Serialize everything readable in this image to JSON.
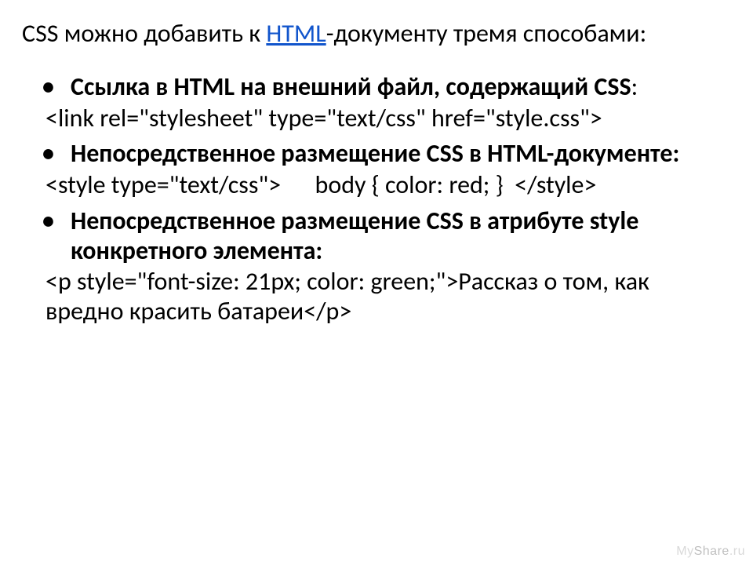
{
  "intro": {
    "before_link": "CSS можно добавить к ",
    "link": "HTML",
    "after_link": "-документу тремя способами:"
  },
  "items": [
    {
      "bold": "Ссылка в HTML на внешний файл, содержащий CSS",
      "tail": ":"
    },
    {
      "bold": "Непосредственное размещение CSS в HTML-документе:",
      "tail": ""
    },
    {
      "bold": "Непосредственное размещение CSS в атрибуте style конкретного элемента:",
      "tail": ""
    }
  ],
  "code": {
    "link_example": "<link rel=\"stylesheet\" type=\"text/css\" href=\"style.css\">",
    "style_open": "<style type=\"text/css\">",
    "style_body": "body { color: red; }",
    "style_close": "</style>",
    "p_example": "<p style=\"font-size: 21px; color: green;\">Рассказ о том, как вредно красить батареи</p>"
  },
  "watermark": {
    "my": "My",
    "share": "Share",
    "dot": ".",
    "ru": "ru"
  }
}
